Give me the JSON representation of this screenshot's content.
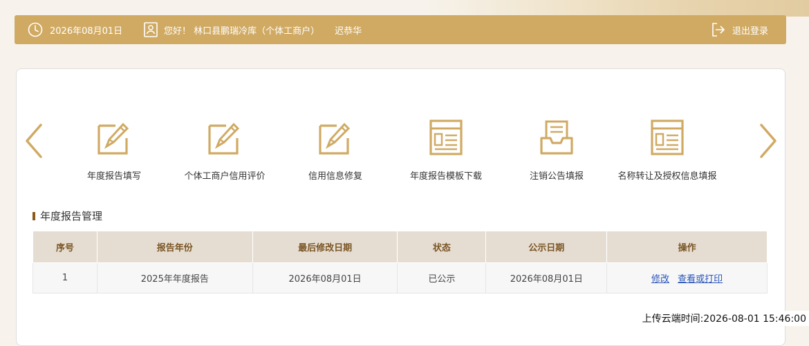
{
  "header": {
    "date": "2026年08月01日",
    "greeting": "您好！ 林口县鹏瑞冷库（个体工商户）",
    "person": "迟恭华",
    "logout_label": "退出登录",
    "icons": {
      "date": "clock-icon",
      "user": "user-card-icon",
      "logout": "logout-icon"
    }
  },
  "menu": {
    "items": [
      {
        "label": "年度报告填写",
        "icon": "edit-icon"
      },
      {
        "label": "个体工商户信用评价",
        "icon": "edit-icon"
      },
      {
        "label": "信用信息修复",
        "icon": "edit-icon"
      },
      {
        "label": "年度报告模板下载",
        "icon": "form-window-icon"
      },
      {
        "label": "注销公告填报",
        "icon": "tray-document-icon"
      },
      {
        "label": "名称转让及授权信息填报",
        "icon": "form-window-icon"
      }
    ],
    "prev_icon": "chevron-left-icon",
    "next_icon": "chevron-right-icon"
  },
  "section": {
    "title": "年度报告管理"
  },
  "table": {
    "headers": [
      "序号",
      "报告年份",
      "最后修改日期",
      "状态",
      "公示日期",
      "操作"
    ],
    "rows": [
      {
        "index": "1",
        "year": "2025年年度报告",
        "modified": "2026年08月01日",
        "status": "已公示",
        "publish": "2026年08月01日",
        "action_edit": "修改",
        "action_view": "查看或打印"
      }
    ]
  },
  "footer": {
    "upload_time": "上传云端时间:2026-08-01 15:46:00"
  },
  "colors": {
    "accent": "#d0aa63",
    "header_text": "#7a5524",
    "link": "#2a55b8"
  }
}
